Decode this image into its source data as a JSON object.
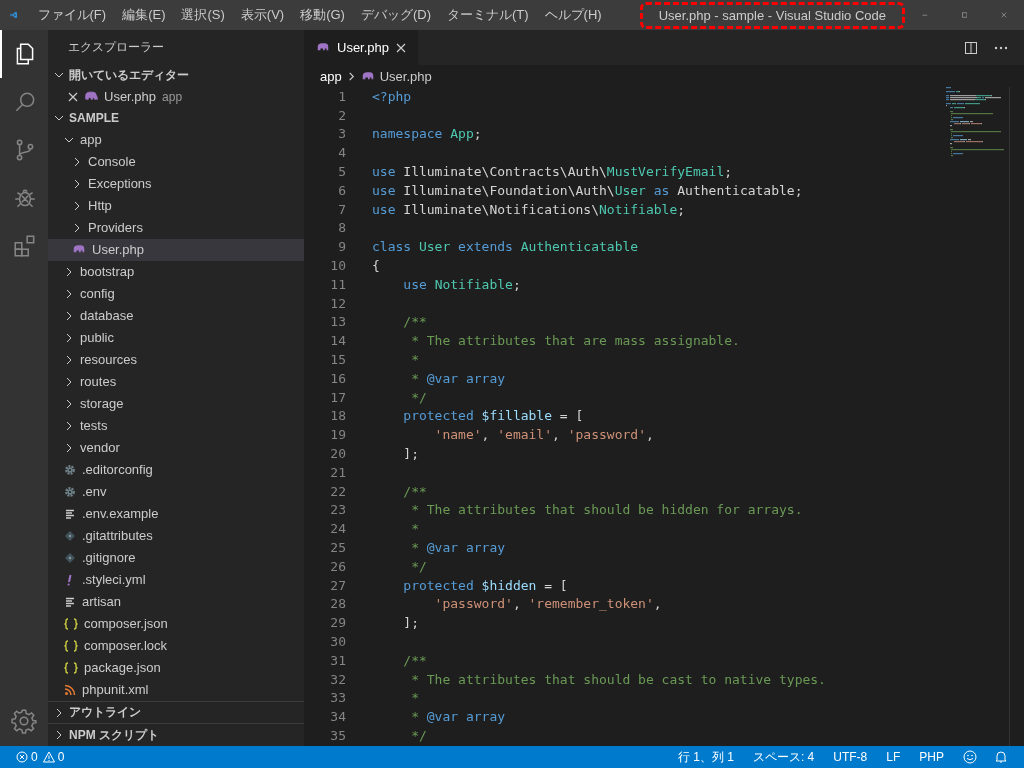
{
  "window": {
    "title": "User.php - sample - Visual Studio Code",
    "title_highlighted": true
  },
  "menu": [
    "ファイル(F)",
    "編集(E)",
    "選択(S)",
    "表示(V)",
    "移動(G)",
    "デバッグ(D)",
    "ターミナル(T)",
    "ヘルプ(H)"
  ],
  "activity_bar": [
    {
      "kind": "files",
      "selected": true
    },
    {
      "kind": "search",
      "selected": false
    },
    {
      "kind": "scm",
      "selected": false
    },
    {
      "kind": "debug",
      "selected": false
    },
    {
      "kind": "extensions",
      "selected": false
    }
  ],
  "explorer": {
    "title": "エクスプローラー",
    "open_editors": {
      "label": "開いているエディター",
      "expanded": true,
      "items": [
        {
          "name": "User.php",
          "path": "app",
          "kind": "php"
        }
      ]
    },
    "folder": {
      "label": "SAMPLE",
      "expanded": true
    },
    "tree": [
      {
        "label": "app",
        "kind": "folder",
        "expanded": true,
        "selected": false,
        "children": [
          {
            "label": "Console",
            "kind": "folder",
            "expanded": false,
            "selected": false
          },
          {
            "label": "Exceptions",
            "kind": "folder",
            "expanded": false,
            "selected": false
          },
          {
            "label": "Http",
            "kind": "folder",
            "expanded": false,
            "selected": false
          },
          {
            "label": "Providers",
            "kind": "folder",
            "expanded": false,
            "selected": false
          },
          {
            "label": "User.php",
            "kind": "php",
            "selected": true
          }
        ]
      },
      {
        "label": "bootstrap",
        "kind": "folder",
        "expanded": false,
        "selected": false
      },
      {
        "label": "config",
        "kind": "folder",
        "expanded": false,
        "selected": false
      },
      {
        "label": "database",
        "kind": "folder",
        "expanded": false,
        "selected": false
      },
      {
        "label": "public",
        "kind": "folder",
        "expanded": false,
        "selected": false
      },
      {
        "label": "resources",
        "kind": "folder",
        "expanded": false,
        "selected": false
      },
      {
        "label": "routes",
        "kind": "folder",
        "expanded": false,
        "selected": false
      },
      {
        "label": "storage",
        "kind": "folder",
        "expanded": false,
        "selected": false
      },
      {
        "label": "tests",
        "kind": "folder",
        "expanded": false,
        "selected": false
      },
      {
        "label": "vendor",
        "kind": "folder",
        "expanded": false,
        "selected": false
      },
      {
        "label": ".editorconfig",
        "kind": "config",
        "selected": false
      },
      {
        "label": ".env",
        "kind": "config",
        "selected": false
      },
      {
        "label": ".env.example",
        "kind": "text",
        "selected": false
      },
      {
        "label": ".gitattributes",
        "kind": "git",
        "selected": false
      },
      {
        "label": ".gitignore",
        "kind": "git",
        "selected": false
      },
      {
        "label": ".styleci.yml",
        "kind": "yaml",
        "selected": false
      },
      {
        "label": "artisan",
        "kind": "text",
        "selected": false
      },
      {
        "label": "composer.json",
        "kind": "json",
        "selected": false
      },
      {
        "label": "composer.lock",
        "kind": "json",
        "selected": false
      },
      {
        "label": "package.json",
        "kind": "json",
        "selected": false
      },
      {
        "label": "phpunit.xml",
        "kind": "rss",
        "selected": false
      }
    ],
    "bottom_sections": [
      {
        "label": "アウトライン",
        "expanded": false
      },
      {
        "label": "NPM スクリプト",
        "expanded": false
      }
    ]
  },
  "editor": {
    "tabs": [
      {
        "label": "User.php",
        "kind": "php",
        "selected": true
      }
    ],
    "breadcrumb": [
      {
        "label": "app",
        "kind": "folder"
      },
      {
        "label": "User.php",
        "kind": "php"
      }
    ],
    "lines": [
      {
        "n": "1",
        "code": [
          {
            "kind": "kw",
            "t": "<?php"
          }
        ]
      },
      {
        "n": "2"
      },
      {
        "n": "3",
        "code": [
          {
            "kind": "kw",
            "t": "namespace "
          },
          {
            "kind": "type",
            "t": "App"
          },
          {
            "kind": "p",
            "t": ";"
          }
        ]
      },
      {
        "n": "4"
      },
      {
        "n": "5",
        "code": [
          {
            "kind": "kw",
            "t": "use "
          },
          {
            "kind": "p",
            "t": "Illuminate\\Contracts\\Auth\\"
          },
          {
            "kind": "type",
            "t": "MustVerifyEmail"
          },
          {
            "kind": "p",
            "t": ";"
          }
        ]
      },
      {
        "n": "6",
        "code": [
          {
            "kind": "kw",
            "t": "use "
          },
          {
            "kind": "p",
            "t": "Illuminate\\Foundation\\Auth\\"
          },
          {
            "kind": "type",
            "t": "User "
          },
          {
            "kind": "kw",
            "t": "as "
          },
          {
            "kind": "p",
            "t": "Authenticatable;"
          }
        ]
      },
      {
        "n": "7",
        "code": [
          {
            "kind": "kw",
            "t": "use "
          },
          {
            "kind": "p",
            "t": "Illuminate\\Notifications\\"
          },
          {
            "kind": "type",
            "t": "Notifiable"
          },
          {
            "kind": "p",
            "t": ";"
          }
        ]
      },
      {
        "n": "8"
      },
      {
        "n": "9",
        "code": [
          {
            "kind": "kw",
            "t": "class "
          },
          {
            "kind": "type",
            "t": "User "
          },
          {
            "kind": "kw",
            "t": "extends "
          },
          {
            "kind": "type",
            "t": "Authenticatable"
          }
        ]
      },
      {
        "n": "10",
        "code": [
          {
            "kind": "p",
            "t": "{"
          }
        ]
      },
      {
        "n": "11",
        "code": [
          {
            "kind": "kw",
            "t": "    use "
          },
          {
            "kind": "type",
            "t": "Notifiable"
          },
          {
            "kind": "p",
            "t": ";"
          }
        ]
      },
      {
        "n": "12"
      },
      {
        "n": "13",
        "code": [
          {
            "kind": "cmt",
            "t": "    /**"
          }
        ]
      },
      {
        "n": "14",
        "code": [
          {
            "kind": "cmt",
            "t": "     * The attributes that are mass assignable."
          }
        ]
      },
      {
        "n": "15",
        "code": [
          {
            "kind": "cmt",
            "t": "     *"
          }
        ]
      },
      {
        "n": "16",
        "code": [
          {
            "kind": "cmt",
            "t": "     * "
          },
          {
            "kind": "doc",
            "t": "@var array"
          }
        ]
      },
      {
        "n": "17",
        "code": [
          {
            "kind": "cmt",
            "t": "     */"
          }
        ]
      },
      {
        "n": "18",
        "code": [
          {
            "kind": "kw",
            "t": "    protected "
          },
          {
            "kind": "var",
            "t": "$fillable"
          },
          {
            "kind": "p",
            "t": " = ["
          }
        ]
      },
      {
        "n": "19",
        "code": [
          {
            "kind": "str",
            "t": "        'name'"
          },
          {
            "kind": "p",
            "t": ", "
          },
          {
            "kind": "str",
            "t": "'email'"
          },
          {
            "kind": "p",
            "t": ", "
          },
          {
            "kind": "str",
            "t": "'password'"
          },
          {
            "kind": "p",
            "t": ","
          }
        ]
      },
      {
        "n": "20",
        "code": [
          {
            "kind": "p",
            "t": "    ];"
          }
        ]
      },
      {
        "n": "21"
      },
      {
        "n": "22",
        "code": [
          {
            "kind": "cmt",
            "t": "    /**"
          }
        ]
      },
      {
        "n": "23",
        "code": [
          {
            "kind": "cmt",
            "t": "     * The attributes that should be hidden for arrays."
          }
        ]
      },
      {
        "n": "24",
        "code": [
          {
            "kind": "cmt",
            "t": "     *"
          }
        ]
      },
      {
        "n": "25",
        "code": [
          {
            "kind": "cmt",
            "t": "     * "
          },
          {
            "kind": "doc",
            "t": "@var array"
          }
        ]
      },
      {
        "n": "26",
        "code": [
          {
            "kind": "cmt",
            "t": "     */"
          }
        ]
      },
      {
        "n": "27",
        "code": [
          {
            "kind": "kw",
            "t": "    protected "
          },
          {
            "kind": "var",
            "t": "$hidden"
          },
          {
            "kind": "p",
            "t": " = ["
          }
        ]
      },
      {
        "n": "28",
        "code": [
          {
            "kind": "str",
            "t": "        'password'"
          },
          {
            "kind": "p",
            "t": ", "
          },
          {
            "kind": "str",
            "t": "'remember_token'"
          },
          {
            "kind": "p",
            "t": ","
          }
        ]
      },
      {
        "n": "29",
        "code": [
          {
            "kind": "p",
            "t": "    ];"
          }
        ]
      },
      {
        "n": "30"
      },
      {
        "n": "31",
        "code": [
          {
            "kind": "cmt",
            "t": "    /**"
          }
        ]
      },
      {
        "n": "32",
        "code": [
          {
            "kind": "cmt",
            "t": "     * The attributes that should be cast to native types."
          }
        ]
      },
      {
        "n": "33",
        "code": [
          {
            "kind": "cmt",
            "t": "     *"
          }
        ]
      },
      {
        "n": "34",
        "code": [
          {
            "kind": "cmt",
            "t": "     * "
          },
          {
            "kind": "doc",
            "t": "@var array"
          }
        ]
      },
      {
        "n": "35",
        "code": [
          {
            "kind": "cmt",
            "t": "     */"
          }
        ]
      }
    ]
  },
  "status_bar": {
    "errors": "0",
    "warnings": "0",
    "items": [
      "行 1、列 1",
      "スペース: 4",
      "UTF-8",
      "LF",
      "PHP"
    ]
  }
}
